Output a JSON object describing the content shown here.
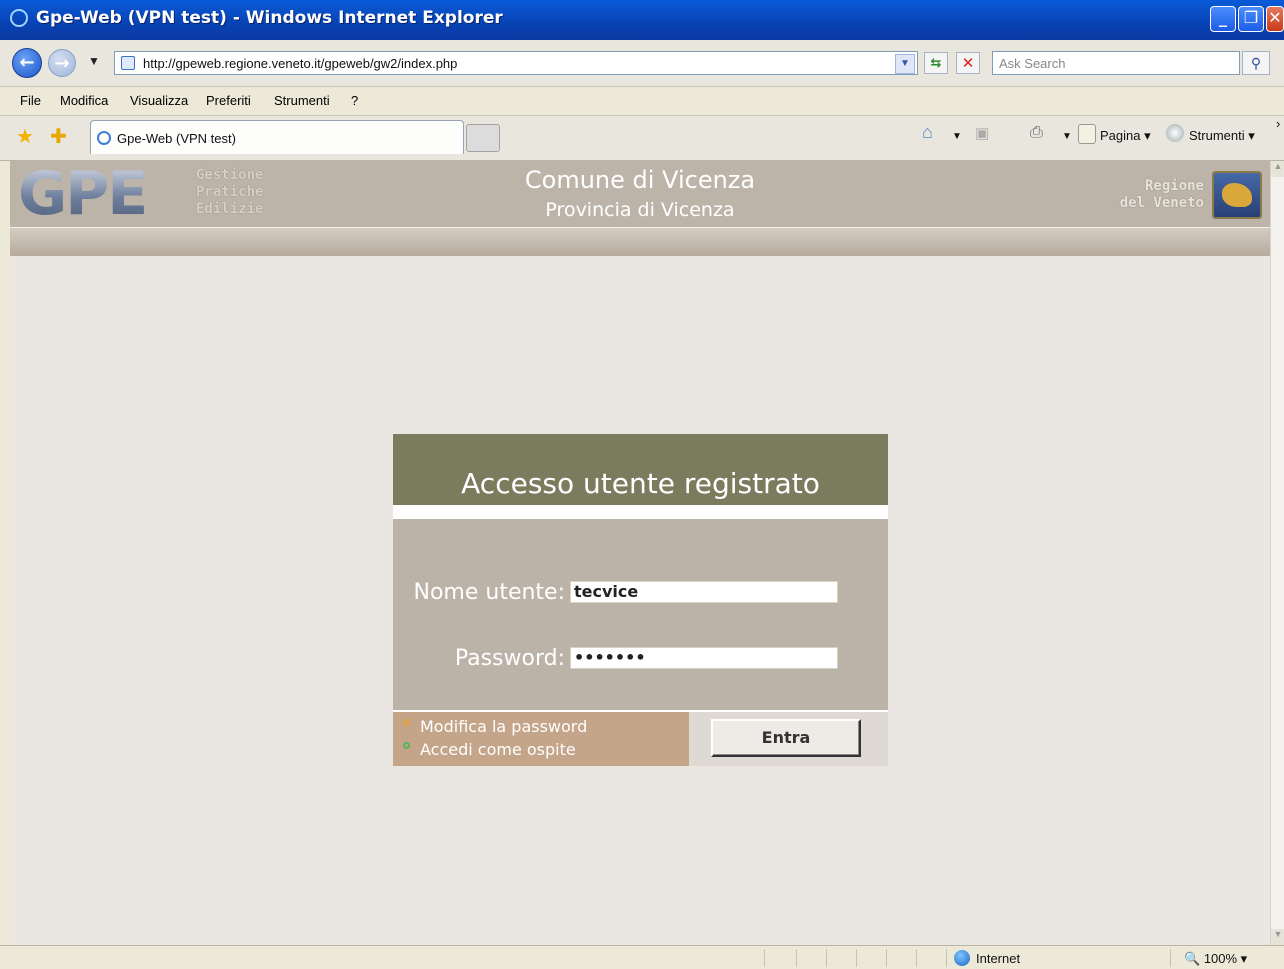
{
  "window": {
    "title": "Gpe-Web (VPN test) - Windows Internet Explorer",
    "buttons": [
      "_",
      "❐",
      "✕"
    ]
  },
  "address_bar": {
    "url": "http://gpeweb.regione.veneto.it/gpeweb/gw2/index.php",
    "search_placeholder": "Ask Search"
  },
  "menu": [
    "File",
    "Modifica",
    "Visualizza",
    "Preferiti",
    "Strumenti",
    "?"
  ],
  "tab": {
    "label": "Gpe-Web (VPN test)"
  },
  "commands": {
    "page": "Pagina ▾",
    "tools": "Strumenti ▾"
  },
  "header": {
    "logo": "GPE",
    "logo_sub": [
      "Gestione",
      "Pratiche",
      "Edilizie"
    ],
    "comune": "Comune di Vicenza",
    "provincia": "Provincia di Vicenza",
    "regione": [
      "Regione",
      "del Veneto"
    ]
  },
  "login": {
    "title": "Accesso utente registrato",
    "username_label": "Nome utente:",
    "username_value": "tecvice",
    "password_label": "Password:",
    "password_value": "•••••••",
    "link_change_password": "Modifica la password",
    "link_guest": "Accedi come ospite",
    "submit_label": "Entra"
  },
  "status_bar": {
    "zone": "Internet",
    "zoom": "100%"
  },
  "colors": {
    "header_bg": "#bcb4a8",
    "login_head": "#7b7b5e",
    "login_body": "#bbb3a7",
    "links_bg": "#c4a589",
    "bullet_orange": "#e8a23a",
    "bullet_green": "#58b35a"
  }
}
